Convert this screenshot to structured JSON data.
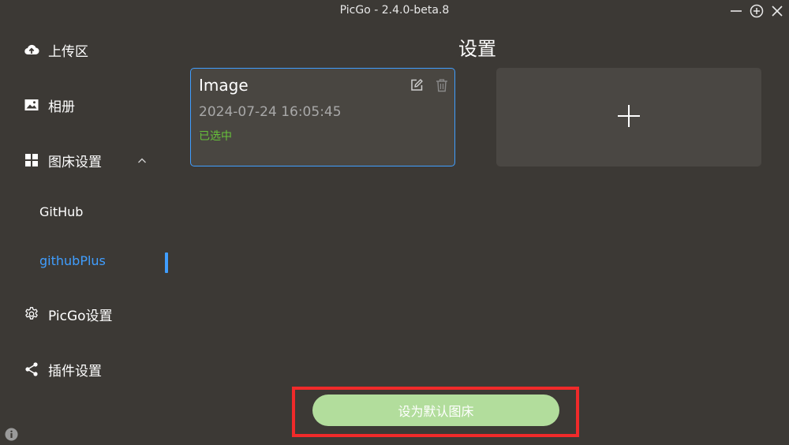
{
  "window": {
    "title": "PicGo - 2.4.0-beta.8",
    "controls": [
      "minimize-icon",
      "maximize-icon",
      "close-icon"
    ]
  },
  "sidebar": {
    "items": [
      {
        "label": "上传区",
        "icon": "cloud-upload-icon"
      },
      {
        "label": "相册",
        "icon": "image-icon"
      },
      {
        "label": "图床设置",
        "icon": "grid-icon",
        "expanded": true
      },
      {
        "label": "PicGo设置",
        "icon": "gear-icon"
      },
      {
        "label": "插件设置",
        "icon": "share-icon"
      }
    ],
    "subitems": [
      {
        "label": "GitHub",
        "active": false
      },
      {
        "label": "githubPlus",
        "active": true
      }
    ]
  },
  "main": {
    "title": "设置",
    "configs": [
      {
        "name": "Image",
        "date": "2024-07-24 16:05:45",
        "status": "已选中",
        "selected": true
      }
    ],
    "add_icon": "plus-icon",
    "default_button": "设为默认图床"
  },
  "colors": {
    "background": "#3c3935",
    "accent": "#409eff",
    "selected_text": "#67c23a",
    "button": "#b2dd9c",
    "highlight": "#f02a2a"
  }
}
